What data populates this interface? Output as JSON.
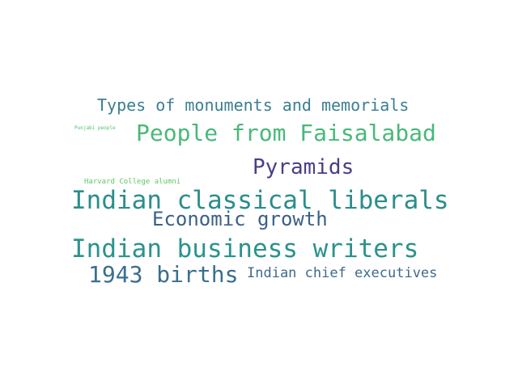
{
  "word_cloud": {
    "words": [
      {
        "id": "types-monuments",
        "text": "Types of monuments and memorials",
        "color": "#3b7f8f"
      },
      {
        "id": "people-faisalabad",
        "text": "People from Faisalabad",
        "color": "#49b87a"
      },
      {
        "id": "pyramids",
        "text": "Pyramids",
        "color": "#4a3f86"
      },
      {
        "id": "punjabi-people",
        "text": "Punjabi people",
        "color": "#4cc26b"
      },
      {
        "id": "harvard-alumni",
        "text": "Harvard College alumni",
        "color": "#5ec962"
      },
      {
        "id": "indian-classical",
        "text": "Indian classical liberals",
        "color": "#2a8e8a"
      },
      {
        "id": "economic-growth",
        "text": "Economic growth",
        "color": "#3c5f8a"
      },
      {
        "id": "indian-business",
        "text": "Indian business writers",
        "color": "#2a938b"
      },
      {
        "id": "1943-births",
        "text": "1943 births",
        "color": "#3a6f8d"
      },
      {
        "id": "indian-chief",
        "text": "Indian chief executives",
        "color": "#3f6a8c"
      }
    ]
  }
}
